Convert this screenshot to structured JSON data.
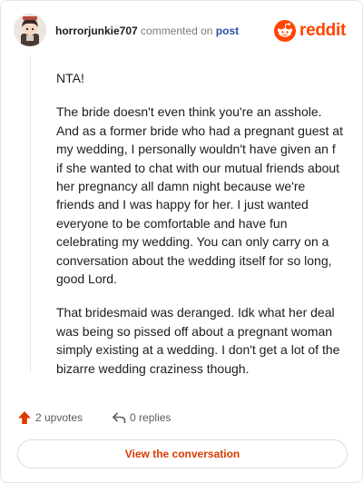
{
  "header": {
    "username": "horrorjunkie707",
    "action_text": "commented on",
    "post_link": "post",
    "brand_word": "reddit",
    "brand_color": "#ff4500"
  },
  "comment": {
    "paragraphs": [
      "NTA!",
      "The bride doesn't even think you're an asshole. And as a former bride who had a pregnant guest at my wedding, I personally wouldn't have given an f if she wanted to chat with our mutual friends about her pregnancy all damn night because we're friends and I was happy for her. I just wanted everyone to be comfortable and have fun celebrating my wedding. You can only carry on a conversation about the wedding itself for so long, good Lord.",
      "That bridesmaid was deranged. Idk what her deal was being so pissed off about a pregnant woman simply existing at a wedding. I don't get a lot of the bizarre wedding craziness though."
    ]
  },
  "footer": {
    "upvotes_label": "2 upvotes",
    "replies_label": "0 replies",
    "upvote_icon": "upvote-arrow-icon",
    "reply_icon": "reply-arrow-icon",
    "accent_color": "#d93a00"
  },
  "cta": {
    "label": "View the conversation"
  }
}
